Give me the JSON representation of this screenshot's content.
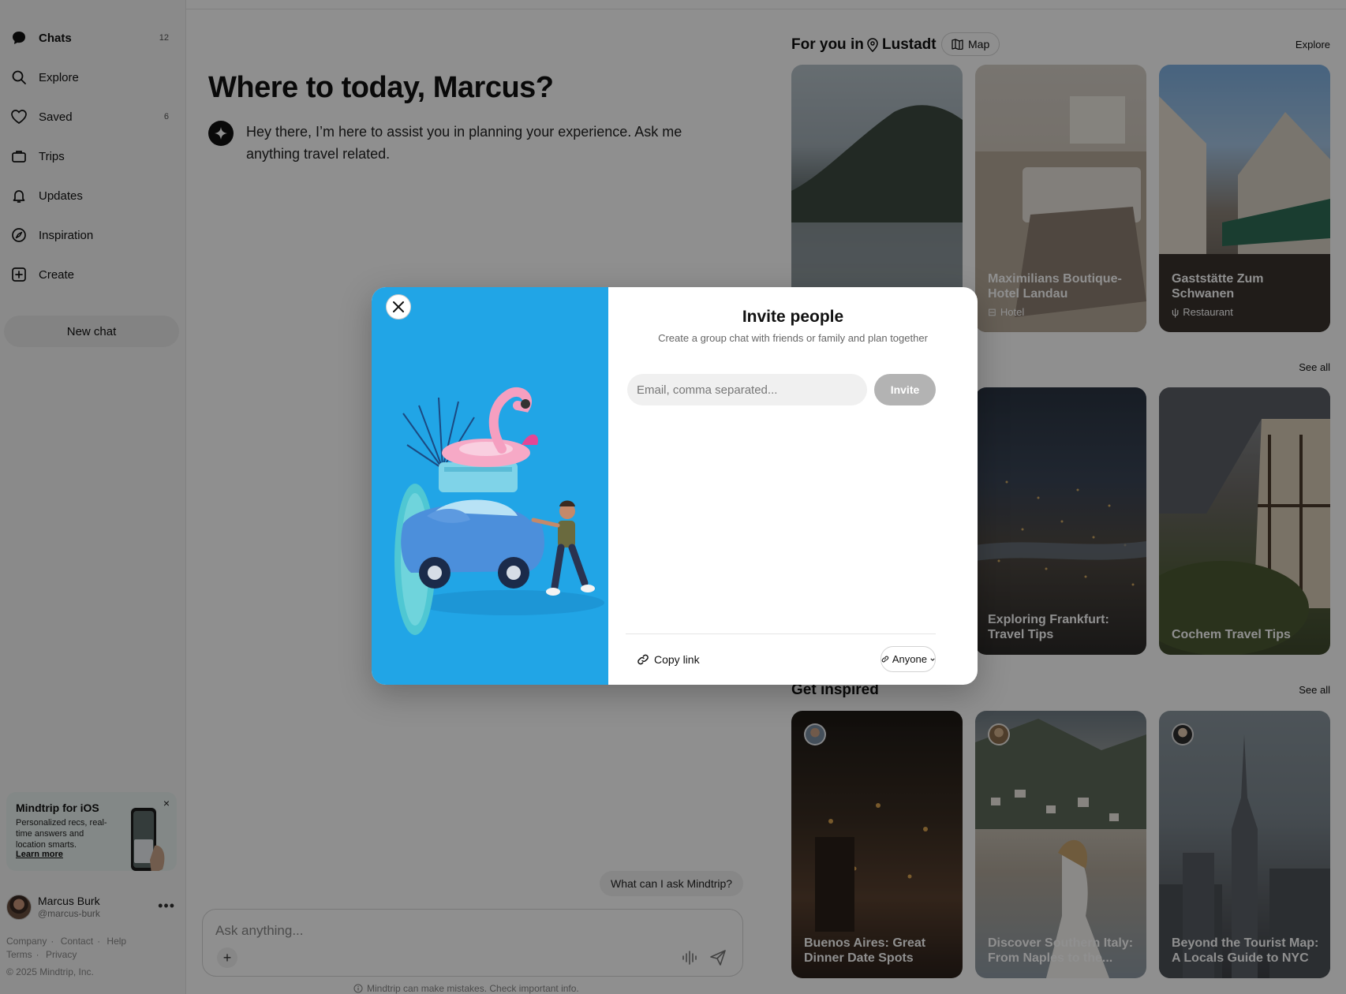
{
  "sidebar": {
    "items": [
      {
        "label": "Chats",
        "icon": "chat-bubble-icon",
        "count": "12"
      },
      {
        "label": "Explore",
        "icon": "search-icon",
        "count": ""
      },
      {
        "label": "Saved",
        "icon": "heart-icon",
        "count": "6"
      },
      {
        "label": "Trips",
        "icon": "suitcase-icon",
        "count": ""
      },
      {
        "label": "Updates",
        "icon": "bell-icon",
        "count": ""
      },
      {
        "label": "Inspiration",
        "icon": "compass-icon",
        "count": ""
      },
      {
        "label": "Create",
        "icon": "plus-square-icon",
        "count": ""
      }
    ],
    "new_chat": "New chat",
    "promo": {
      "title": "Mindtrip for iOS",
      "description": "Personalized recs, real-time answers and location smarts.",
      "link": "Learn more",
      "close": "×"
    },
    "user": {
      "name": "Marcus Burk",
      "handle": "@marcus-burk",
      "more": "•••"
    },
    "footer": {
      "links": [
        "Company",
        "Contact",
        "Help",
        "Terms",
        "Privacy"
      ],
      "copyright": "© 2025 Mindtrip, Inc."
    }
  },
  "main": {
    "greeting": "Where to today, Marcus?",
    "bot_message": "Hey there, I’m here to assist you in planning your experience. Ask me anything travel related.",
    "suggestion": "What can I ask Mindtrip?",
    "composer_placeholder": "Ask anything...",
    "composer_plus": "+",
    "disclaimer": "Mindtrip can make mistakes. Check important info."
  },
  "right_panel": {
    "for_you_label": "For you in",
    "location": "Lustadt",
    "map_button": "Map",
    "explore_link": "Explore",
    "see_all_1": "See all",
    "get_inspired": "Get inspired",
    "see_all_2": "See all",
    "cards_row1": [
      {
        "title": "",
        "tag": ""
      },
      {
        "title": "Maximilians Boutique-Hotel Landau",
        "tag": "Hotel",
        "tag_icon": "bed-icon"
      },
      {
        "title": "Gaststätte Zum Schwanen",
        "tag": "Restaurant",
        "tag_icon": "fork-knife-icon"
      }
    ],
    "cards_row2": [
      {
        "title": "Exploring Frankfurt: Travel Tips"
      },
      {
        "title": "Cochem Travel Tips"
      }
    ],
    "cards_row3": [
      {
        "title": "Buenos Aires: Great Dinner Date Spots"
      },
      {
        "title": "Discover Southern Italy: From Naples to the..."
      },
      {
        "title": "Beyond the Tourist Map: A Locals Guide to NYC"
      }
    ]
  },
  "modal": {
    "title": "Invite people",
    "subtitle": "Create a group chat with friends or family and plan together",
    "email_placeholder": "Email, comma separated...",
    "invite_button": "Invite",
    "copy_link": "Copy link",
    "access_button": "Anyone"
  },
  "colors": {
    "modal_art_bg": "#21a5e6",
    "invite_disabled": "#b3b3b3",
    "promo_bg": "#eaf3f0"
  }
}
